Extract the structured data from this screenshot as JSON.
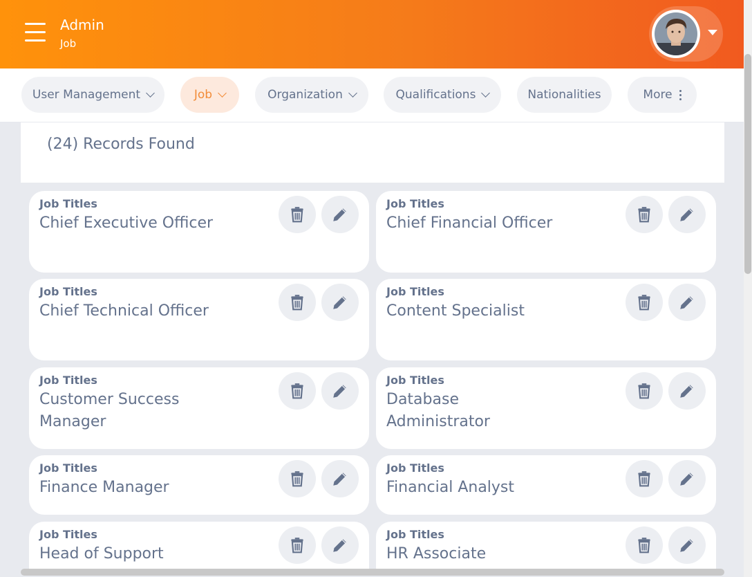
{
  "header": {
    "title": "Admin",
    "subtitle": "Job",
    "menu_icon": "hamburger-menu-icon",
    "avatar_icon": "user-avatar",
    "dropdown_icon": "caret-down-icon",
    "gradient_start": "#ff920b",
    "gradient_end": "#f15a1f"
  },
  "tabs": [
    {
      "label": "User Management",
      "has_dropdown": true,
      "active": false
    },
    {
      "label": "Job",
      "has_dropdown": true,
      "active": true
    },
    {
      "label": "Organization",
      "has_dropdown": true,
      "active": false
    },
    {
      "label": "Qualifications",
      "has_dropdown": true,
      "active": false
    },
    {
      "label": "Nationalities",
      "has_dropdown": false,
      "active": false
    },
    {
      "label": "More",
      "has_dropdown": false,
      "active": false,
      "icon": "kebab-menu-icon"
    }
  ],
  "records": {
    "text": "(24) Records Found"
  },
  "card_field_label": "Job Titles",
  "actions": {
    "delete_icon": "trash-icon",
    "edit_icon": "pencil-icon"
  },
  "jobs": [
    "Chief Executive Officer",
    "Chief Financial Officer",
    "Chief Technical Officer",
    "Content Specialist",
    "Customer Success Manager",
    "Database Administrator",
    "Finance Manager",
    "Financial Analyst",
    "Head of Support",
    "HR Associate"
  ],
  "colors": {
    "accent": "#f28c38",
    "text": "#64728c",
    "background": "#e8eaef",
    "button_bg": "#eceef2"
  }
}
